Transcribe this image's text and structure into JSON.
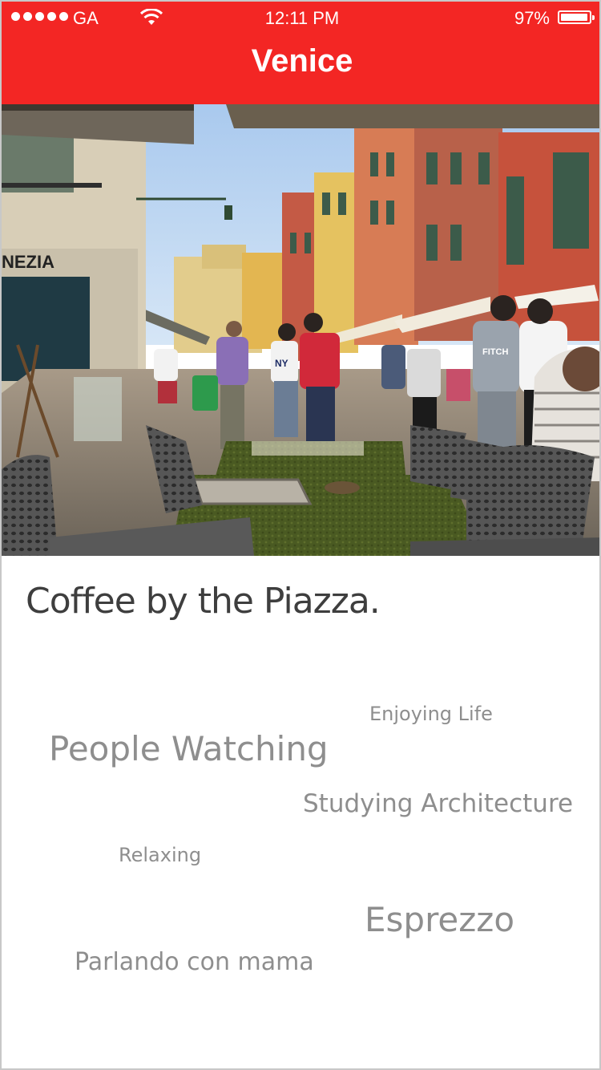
{
  "status_bar": {
    "carrier": "GA",
    "time": "12:11 PM",
    "battery": "97%",
    "battery_level": 0.97,
    "signal_bars": 5
  },
  "header": {
    "title": "Venice",
    "background_color": "#f32624"
  },
  "hero": {
    "storefront_sign": "NEZIA",
    "shirt_text_1": "NY",
    "shirt_text_2": "FITCH"
  },
  "content": {
    "headline": "Coffee by the Piazza.",
    "tags": [
      "Enjoying Life",
      "People Watching",
      "Studying Architecture",
      "Relaxing",
      "Esprezzo",
      "Parlando con mama"
    ]
  }
}
